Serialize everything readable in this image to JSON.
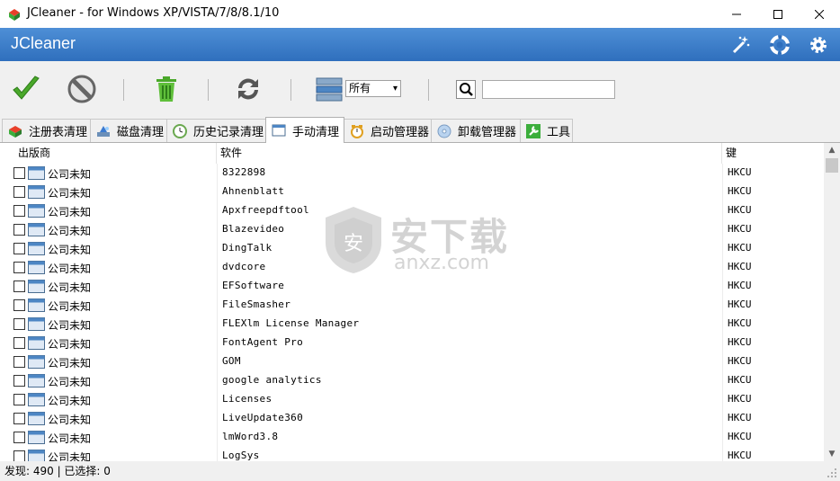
{
  "window": {
    "title": "JCleaner - for Windows XP/VISTA/7/8/8.1/10",
    "minimize": "—",
    "maximize": "☐",
    "close": "✕"
  },
  "header": {
    "title": "JCleaner",
    "icons": [
      "magic-wand-icon",
      "lifebuoy-icon",
      "gear-icon"
    ]
  },
  "toolbar": {
    "filter_selected": "所有",
    "filter_arrow": "▾",
    "search_value": ""
  },
  "tabs": [
    {
      "label": "注册表清理",
      "icon": "registry-icon"
    },
    {
      "label": "磁盘清理",
      "icon": "disk-clean-icon"
    },
    {
      "label": "历史记录清理",
      "icon": "history-icon"
    },
    {
      "label": "手动清理",
      "icon": "window-icon",
      "active": true
    },
    {
      "label": "启动管理器",
      "icon": "clock-icon"
    },
    {
      "label": "卸载管理器",
      "icon": "cd-icon"
    },
    {
      "label": "工具",
      "icon": "tools-icon"
    }
  ],
  "columns": {
    "publisher": "出版商",
    "software": "软件",
    "key": "键"
  },
  "rows": [
    {
      "publisher": "公司未知",
      "software": "8322898",
      "key": "HKCU"
    },
    {
      "publisher": "公司未知",
      "software": "Ahnenblatt",
      "key": "HKCU"
    },
    {
      "publisher": "公司未知",
      "software": "Apxfreepdftool",
      "key": "HKCU"
    },
    {
      "publisher": "公司未知",
      "software": "Blazevideo",
      "key": "HKCU"
    },
    {
      "publisher": "公司未知",
      "software": "DingTalk",
      "key": "HKCU"
    },
    {
      "publisher": "公司未知",
      "software": "dvdcore",
      "key": "HKCU"
    },
    {
      "publisher": "公司未知",
      "software": "EFSoftware",
      "key": "HKCU"
    },
    {
      "publisher": "公司未知",
      "software": "FileSmasher",
      "key": "HKCU"
    },
    {
      "publisher": "公司未知",
      "software": "FLEXlm License Manager",
      "key": "HKCU"
    },
    {
      "publisher": "公司未知",
      "software": "FontAgent Pro",
      "key": "HKCU"
    },
    {
      "publisher": "公司未知",
      "software": "GOM",
      "key": "HKCU"
    },
    {
      "publisher": "公司未知",
      "software": "google analytics",
      "key": "HKCU"
    },
    {
      "publisher": "公司未知",
      "software": "Licenses",
      "key": "HKCU"
    },
    {
      "publisher": "公司未知",
      "software": "LiveUpdate360",
      "key": "HKCU"
    },
    {
      "publisher": "公司未知",
      "software": "lmWord3.8",
      "key": "HKCU"
    },
    {
      "publisher": "公司未知",
      "software": "LogSys",
      "key": "HKCU"
    }
  ],
  "watermark": {
    "text_cn": "安下载",
    "text_en": "anxz.com",
    "badge": "安"
  },
  "status": {
    "text": "发现: 490 | 已选择: 0"
  },
  "scroll": {
    "up": "▲",
    "down": "▼"
  }
}
